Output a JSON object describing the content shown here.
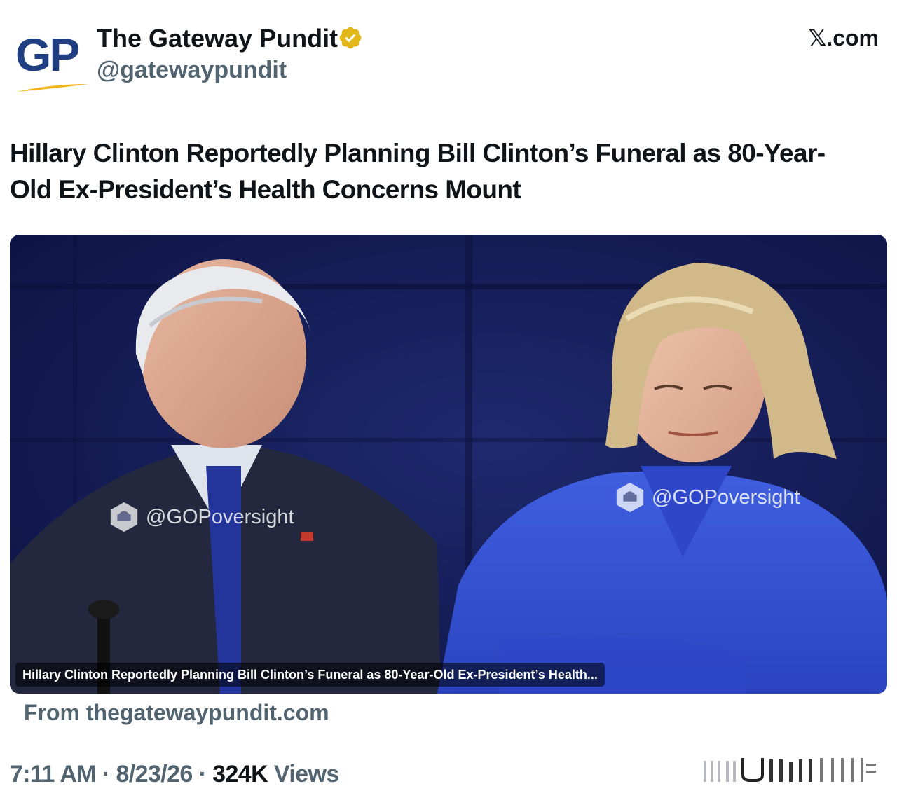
{
  "brand": "𝕏.com",
  "author": {
    "avatar_text": "GP",
    "name": "The Gateway Pundit",
    "handle": "@gatewaypundit",
    "verified": true,
    "verified_color": "#e2b719"
  },
  "post": {
    "headline": "Hillary Clinton Reportedly Planning Bill Clinton’s Funeral as 80-Year-Old Ex-President’s Health Concerns Mount",
    "card": {
      "watermark_left": "@GOPoversight",
      "watermark_right": "@GOPoversight",
      "caption": "Hillary Clinton Reportedly Planning Bill Clinton’s Funeral as 80-Year-Old Ex-President’s Health...",
      "source": "From thegatewaypundit.com"
    },
    "time": "7:11 AM",
    "sep1": " · ",
    "date": "8/23/26",
    "sep2": " · ",
    "views_count": "324K",
    "views_label": " Views"
  },
  "colors": {
    "accent_logo": "#1f3f82",
    "secondary_text": "#536471",
    "card_background": "#141d52"
  },
  "icons": [
    "verified-badge-icon",
    "gop-seal-icon",
    "analytics-icon"
  ]
}
